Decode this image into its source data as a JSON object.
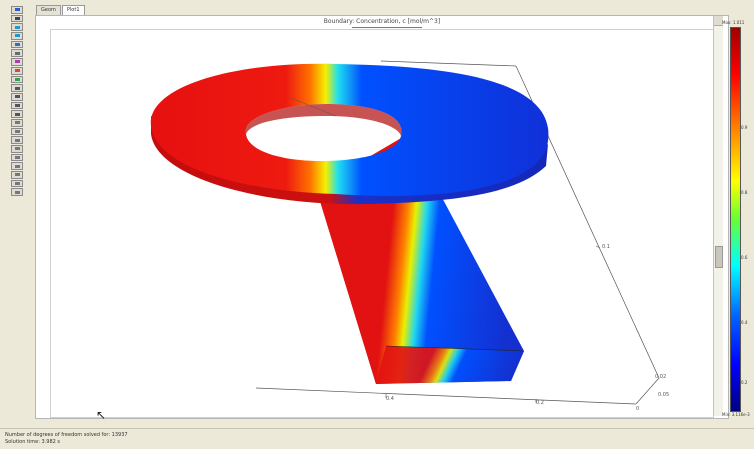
{
  "tabs": [
    {
      "label": "Geom",
      "active": false
    },
    {
      "label": "Plot1",
      "active": true
    }
  ],
  "plot": {
    "title": "Boundary: Concentration, c [mol/m^3]"
  },
  "colorbar": {
    "max_label": "Max: 1.011",
    "min_label": "Min: 3.116e-3",
    "ticks": [
      "0.9",
      "0.8",
      "0.6",
      "0.4",
      "0.2"
    ]
  },
  "axes": {
    "ticks": [
      "0.4",
      "0.2",
      "0.1",
      "0.05",
      "0.02",
      "0"
    ]
  },
  "status": {
    "line1": "Number of degrees of freedom solved for: 13937",
    "line2": "Solution time: 3.982 s"
  }
}
